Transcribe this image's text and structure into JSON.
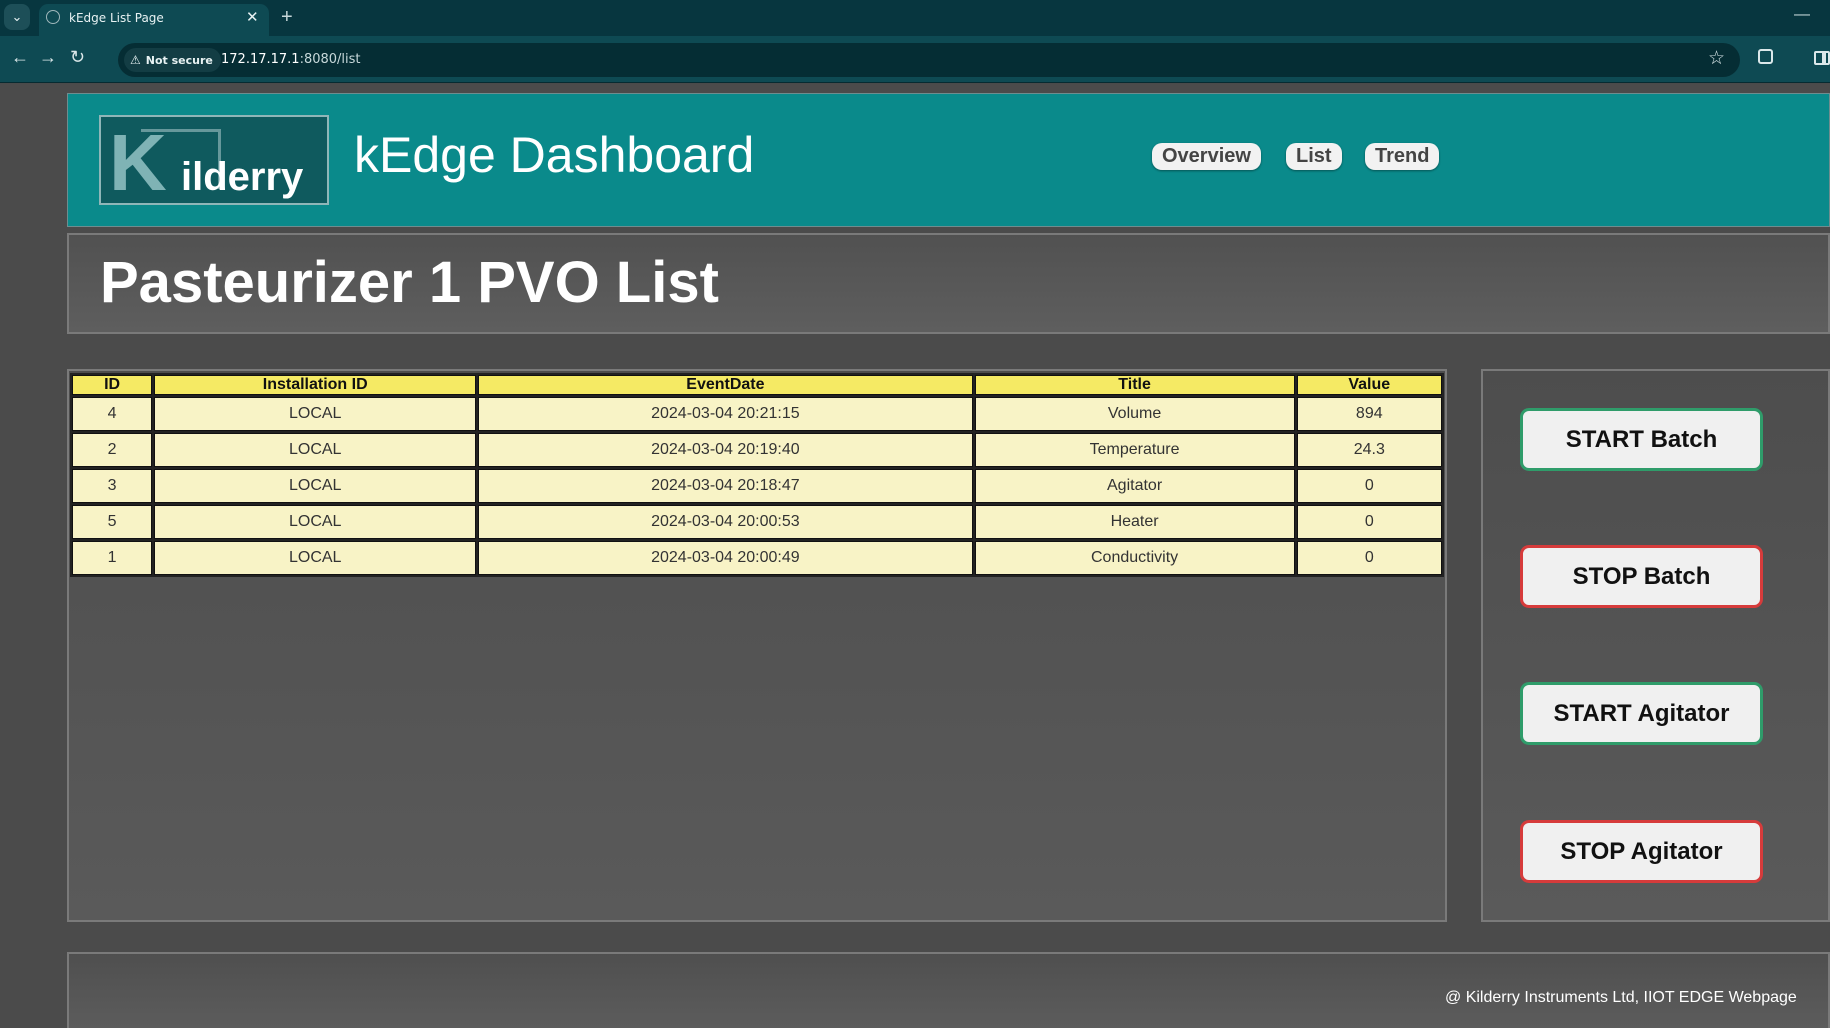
{
  "browser": {
    "tab_title": "kEdge List Page",
    "security_label": "Not secure",
    "url_host": "172.17.17.1",
    "url_rest": ":8080/list"
  },
  "header": {
    "logo_text": "ilderry",
    "logo_letter": "K",
    "app_title": "kEdge Dashboard",
    "nav": [
      {
        "label": "Overview"
      },
      {
        "label": "List"
      },
      {
        "label": "Trend"
      }
    ]
  },
  "page": {
    "heading": "Pasteurizer 1 PVO List"
  },
  "table": {
    "columns": [
      "ID",
      "Installation ID",
      "EventDate",
      "Title",
      "Value"
    ],
    "rows": [
      [
        "4",
        "LOCAL",
        "2024-03-04 20:21:15",
        "Volume",
        "894"
      ],
      [
        "2",
        "LOCAL",
        "2024-03-04 20:19:40",
        "Temperature",
        "24.3"
      ],
      [
        "3",
        "LOCAL",
        "2024-03-04 20:18:47",
        "Agitator",
        "0"
      ],
      [
        "5",
        "LOCAL",
        "2024-03-04 20:00:53",
        "Heater",
        "0"
      ],
      [
        "1",
        "LOCAL",
        "2024-03-04 20:00:49",
        "Conductivity",
        "0"
      ]
    ]
  },
  "controls": {
    "start_batch": "START Batch",
    "stop_batch": "STOP Batch",
    "start_agitator": "START Agitator",
    "stop_agitator": "STOP Agitator"
  },
  "footer": {
    "text": "@ Kilderry Instruments Ltd, IIOT EDGE Webpage"
  },
  "colors": {
    "header_bg": "#0a8a8b",
    "table_header": "#f5ea64",
    "table_cell": "#f8f3c6",
    "start_border": "#2f9c6a",
    "stop_border": "#d63b3b"
  }
}
